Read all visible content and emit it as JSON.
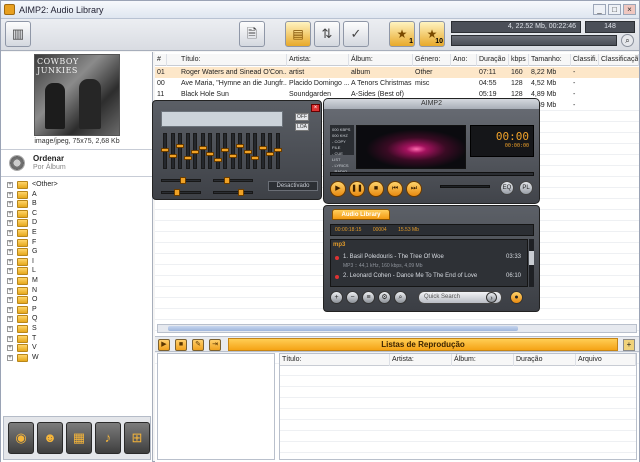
{
  "window": {
    "title": "AIMP2: Audio Library",
    "controls": [
      "_",
      "□",
      "×"
    ]
  },
  "toolbar": {
    "buttons": [
      "library-icon",
      "add-file-icon",
      "add-folder-icon",
      "sort-icon",
      "check-icon"
    ],
    "rating_buttons": [
      {
        "icon": "star-icon",
        "label": "1"
      },
      {
        "icon": "star-icon",
        "label": "10"
      }
    ],
    "stats": "4, 22.52 Mb, 00:22:46",
    "count": "148",
    "search_value": ""
  },
  "left": {
    "cover_text": "COWBOY JUNKIES",
    "cover_info": "image/jpeg, 75x75, 2,68 Kb",
    "order_title": "Ordenar",
    "order_sub": "Por Álbum",
    "tree": [
      "<Other>",
      "A",
      "B",
      "C",
      "D",
      "E",
      "F",
      "G",
      "I",
      "L",
      "M",
      "N",
      "O",
      "P",
      "Q",
      "S",
      "T",
      "V",
      "W"
    ]
  },
  "table": {
    "headers": [
      "#",
      "Título:",
      "Artista:",
      "Álbum:",
      "Género:",
      "Ano:",
      "Duração",
      "kbps",
      "Tamanho:",
      "Classifi...",
      "Classificação"
    ],
    "rows": [
      [
        "01",
        "Roger Waters and Sinead O'Con...",
        "artist",
        "album",
        "Other",
        "",
        "07:11",
        "160",
        "8,22 Mb",
        "-",
        ""
      ],
      [
        "00",
        "Ave Maria, \"Hymne an die Jungfr...",
        "Placido Domingo ...",
        "A Tenors Christmas",
        "misc",
        "",
        "04:55",
        "128",
        "4,52 Mb",
        "-",
        ""
      ],
      [
        "11",
        "Black Hole Sun",
        "Soundgarden",
        "A-Sides (Best of)",
        "",
        "",
        "05:19",
        "128",
        "4,89 Mb",
        "-",
        ""
      ],
      [
        "",
        "",
        "",
        "",
        "",
        "",
        "",
        "",
        "4,89 Mb",
        "-",
        ""
      ]
    ]
  },
  "playlist": {
    "title": "Listas de Reprodução",
    "buttons": [
      "play-icon",
      "stop-icon",
      "edit-icon",
      "export-icon"
    ],
    "headers": [
      "Título:",
      "Artista:",
      "Álbum:",
      "Duração",
      "Arquivo"
    ]
  },
  "equalizer": {
    "labels": [
      "OFF",
      "LOA"
    ],
    "preset": "Desactivado"
  },
  "player": {
    "title": "AIMP2",
    "info_lines": [
      "000 KBPS",
      "000 KHZ",
      "- COPY FILE",
      "- CUE LIST",
      "- LYRICS",
      "- RADIO"
    ],
    "time": "00:00",
    "time_sub": "00:00:00"
  },
  "library": {
    "tab": "Audio Library",
    "info": [
      "00:00:18:15",
      "00004",
      "15.53 Mb"
    ],
    "group": "mp3",
    "tracks": [
      {
        "title": "1. Basil Poledouris - The Tree Of Woe",
        "duration": "03:33",
        "sub": "MP3 :: 44,1 kHz, 160 kbps, 4,09 Mb"
      },
      {
        "title": "2. Leonard Cohen - Dance Me To The End of Love",
        "duration": "06:10",
        "sub": ""
      }
    ],
    "search_placeholder": "Quick Search"
  },
  "colors": {
    "accent": "#f5a315",
    "selection": "#fde7c9",
    "dark": "#41444a"
  }
}
